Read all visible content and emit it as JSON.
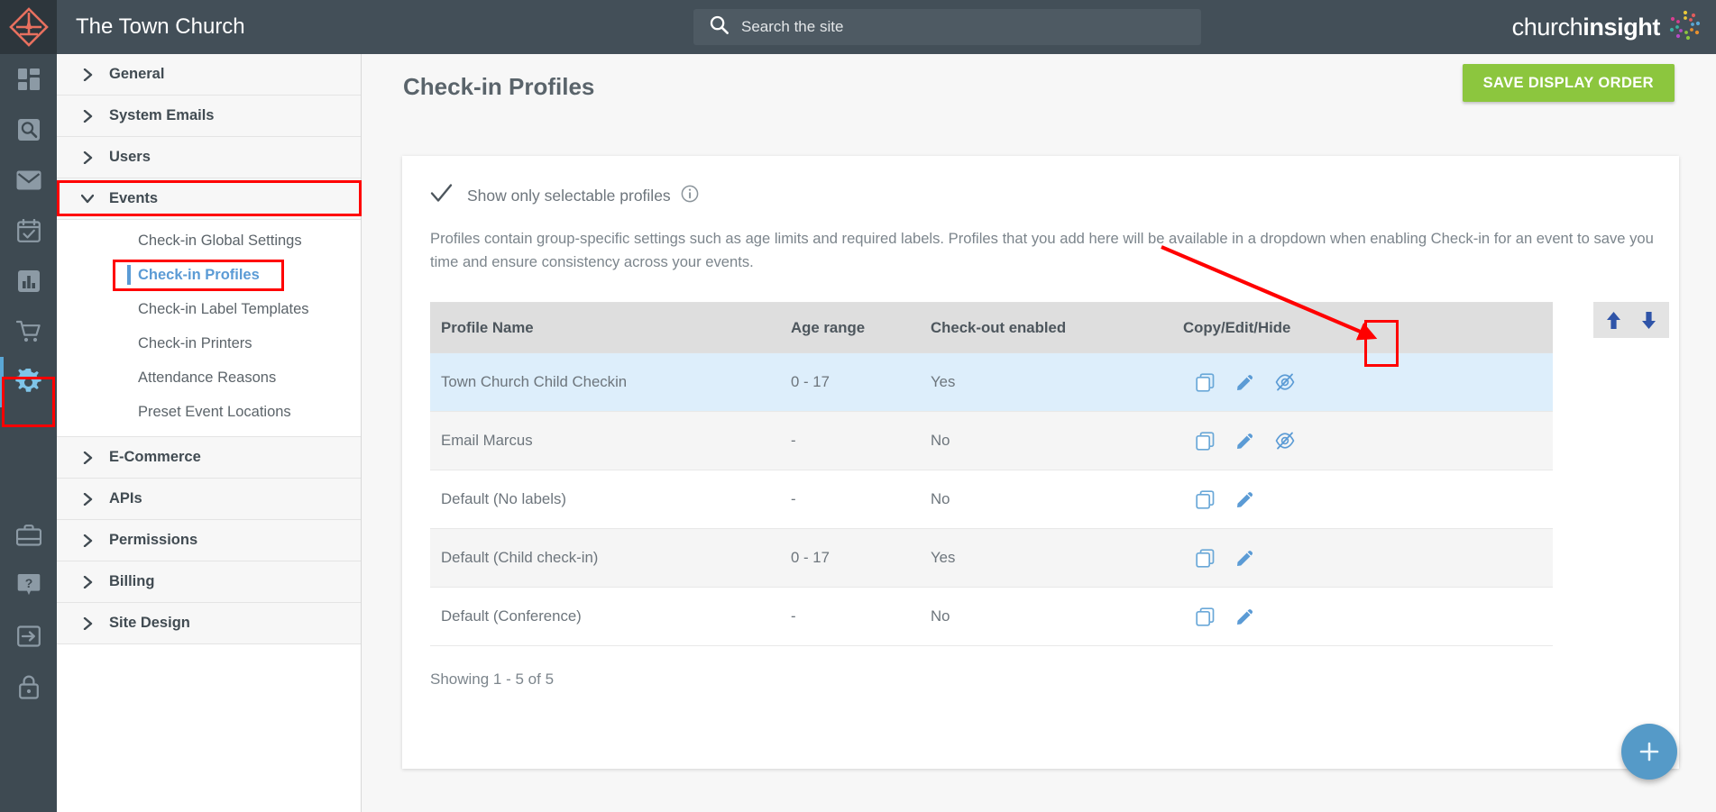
{
  "topbar": {
    "site_title": "The Town Church",
    "search_placeholder": "Search the site",
    "search_value": "",
    "brand_light": "church",
    "brand_bold": "insight"
  },
  "rail": {
    "items": [
      {
        "name": "dashboard-icon",
        "label": "Dashboard"
      },
      {
        "name": "search-icon",
        "label": "Search"
      },
      {
        "name": "mail-icon",
        "label": "Mail"
      },
      {
        "name": "calendar-icon",
        "label": "Calendar"
      },
      {
        "name": "chart-icon",
        "label": "Reports"
      },
      {
        "name": "cart-icon",
        "label": "Shop"
      },
      {
        "name": "gear-icon",
        "label": "Settings"
      },
      {
        "name": "briefcase-icon",
        "label": "Admin"
      },
      {
        "name": "help-icon",
        "label": "Help"
      },
      {
        "name": "login-icon",
        "label": "Sign in"
      },
      {
        "name": "lock-icon",
        "label": "Security"
      }
    ]
  },
  "nav": {
    "groups_top": [
      {
        "label": "General",
        "expanded": false
      },
      {
        "label": "System Emails",
        "expanded": false
      },
      {
        "label": "Users",
        "expanded": false
      },
      {
        "label": "Events",
        "expanded": true
      }
    ],
    "events_children": [
      {
        "label": "Check-in Global Settings",
        "selected": false
      },
      {
        "label": "Check-in Profiles",
        "selected": true
      },
      {
        "label": "Check-in Label Templates",
        "selected": false
      },
      {
        "label": "Check-in Printers",
        "selected": false
      },
      {
        "label": "Attendance Reasons",
        "selected": false
      },
      {
        "label": "Preset Event Locations",
        "selected": false
      }
    ],
    "groups_bottom": [
      {
        "label": "E-Commerce",
        "expanded": false
      },
      {
        "label": "APIs",
        "expanded": false
      },
      {
        "label": "Permissions",
        "expanded": false
      },
      {
        "label": "Billing",
        "expanded": false
      },
      {
        "label": "Site Design",
        "expanded": false
      }
    ]
  },
  "page": {
    "title": "Check-in Profiles",
    "save_button": "SAVE DISPLAY ORDER",
    "selectable_label": "Show only selectable profiles",
    "description": "Profiles contain group-specific settings such as age limits and required labels. Profiles that you add here will be available in a dropdown when enabling Check-in for an event to save you time and ensure consistency across your events.",
    "showing": "Showing 1 - 5 of 5",
    "fab_label": "+"
  },
  "table": {
    "columns": [
      "Profile Name",
      "Age range",
      "Check-out enabled",
      "Copy/Edit/Hide"
    ],
    "rows": [
      {
        "name": "Town Church Child Checkin",
        "age": "0 - 17",
        "checkout": "Yes",
        "actions": [
          "copy",
          "edit",
          "hide"
        ],
        "highlight": true
      },
      {
        "name": "Email Marcus",
        "age": "-",
        "checkout": "No",
        "actions": [
          "copy",
          "edit",
          "hide"
        ],
        "highlight": false
      },
      {
        "name": "Default (No labels)",
        "age": "-",
        "checkout": "No",
        "actions": [
          "copy",
          "edit"
        ],
        "highlight": false
      },
      {
        "name": "Default (Child check-in)",
        "age": "0 - 17",
        "checkout": "Yes",
        "actions": [
          "copy",
          "edit"
        ],
        "highlight": false
      },
      {
        "name": "Default (Conference)",
        "age": "-",
        "checkout": "No",
        "actions": [
          "copy",
          "edit"
        ],
        "highlight": false
      }
    ]
  },
  "colors": {
    "topbar_bg": "#434f58",
    "rail_bg": "#3e4a52",
    "accent_blue": "#5b9bd5",
    "save_green": "#8cc63e",
    "row_highlight": "#ddeefb",
    "annotation_red": "#ff0000",
    "fab_blue": "#559ac8"
  }
}
